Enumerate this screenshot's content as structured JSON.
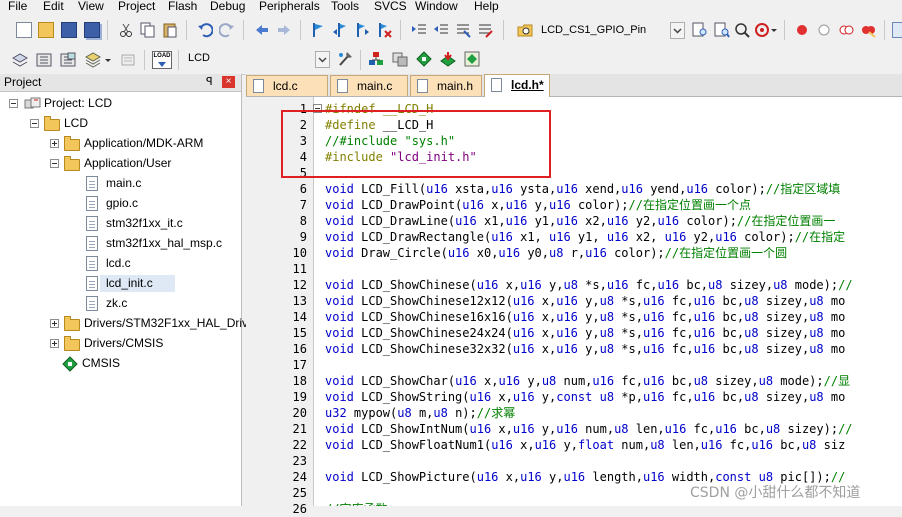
{
  "menu": [
    "File",
    "Edit",
    "View",
    "Project",
    "Flash",
    "Debug",
    "Peripherals",
    "Tools",
    "SVCS",
    "Window",
    "Help"
  ],
  "toolbar": {
    "target_combo": "LCD_CS1_GPIO_Pin",
    "project_combo": "LCD",
    "load_label": "LOAD"
  },
  "project_panel": {
    "title": "Project",
    "pin": "ꟼ",
    "close": "×",
    "root": "Project: LCD",
    "target": "LCD",
    "groups": [
      {
        "name": "Application/MDK-ARM",
        "expanded": false,
        "files": []
      },
      {
        "name": "Application/User",
        "expanded": true,
        "files": [
          "main.c",
          "gpio.c",
          "stm32f1xx_it.c",
          "stm32f1xx_hal_msp.c",
          "lcd.c",
          "lcd_init.c",
          "zk.c"
        ]
      },
      {
        "name": "Drivers/STM32F1xx_HAL_Driv",
        "expanded": false,
        "files": []
      },
      {
        "name": "Drivers/CMSIS",
        "expanded": false,
        "files": []
      },
      {
        "name": "CMSIS",
        "expanded": false,
        "files": []
      }
    ]
  },
  "tabs": [
    {
      "label": "lcd.c",
      "active": false
    },
    {
      "label": "main.c",
      "active": false
    },
    {
      "label": "main.h",
      "active": false
    },
    {
      "label": "lcd.h*",
      "active": true
    }
  ],
  "code_lines": [
    {
      "n": "1",
      "tokens": [
        [
          "p",
          "#ifndef __LCD_H"
        ]
      ]
    },
    {
      "n": "2",
      "tokens": [
        [
          "p",
          "#define "
        ],
        [
          "d",
          "__LCD_H"
        ]
      ]
    },
    {
      "n": "3",
      "tokens": [
        [
          "c",
          "//#include \"sys.h\""
        ]
      ]
    },
    {
      "n": "4",
      "tokens": [
        [
          "p",
          "#include "
        ],
        [
          "s",
          "\"lcd_init.h\""
        ]
      ]
    },
    {
      "n": "5",
      "tokens": []
    },
    {
      "n": "6",
      "tokens": [
        [
          "k",
          "void"
        ],
        [
          "d",
          " LCD_Fill("
        ],
        [
          "k",
          "u16"
        ],
        [
          "d",
          " xsta,"
        ],
        [
          "k",
          "u16"
        ],
        [
          "d",
          " ysta,"
        ],
        [
          "k",
          "u16"
        ],
        [
          "d",
          " xend,"
        ],
        [
          "k",
          "u16"
        ],
        [
          "d",
          " yend,"
        ],
        [
          "k",
          "u16"
        ],
        [
          "d",
          " color);"
        ],
        [
          "c",
          "//指定区域填"
        ]
      ]
    },
    {
      "n": "7",
      "tokens": [
        [
          "k",
          "void"
        ],
        [
          "d",
          " LCD_DrawPoint("
        ],
        [
          "k",
          "u16"
        ],
        [
          "d",
          " x,"
        ],
        [
          "k",
          "u16"
        ],
        [
          "d",
          " y,"
        ],
        [
          "k",
          "u16"
        ],
        [
          "d",
          " color);"
        ],
        [
          "c",
          "//在指定位置画一个点"
        ]
      ]
    },
    {
      "n": "8",
      "tokens": [
        [
          "k",
          "void"
        ],
        [
          "d",
          " LCD_DrawLine("
        ],
        [
          "k",
          "u16"
        ],
        [
          "d",
          " x1,"
        ],
        [
          "k",
          "u16"
        ],
        [
          "d",
          " y1,"
        ],
        [
          "k",
          "u16"
        ],
        [
          "d",
          " x2,"
        ],
        [
          "k",
          "u16"
        ],
        [
          "d",
          " y2,"
        ],
        [
          "k",
          "u16"
        ],
        [
          "d",
          " color);"
        ],
        [
          "c",
          "//在指定位置画一"
        ]
      ]
    },
    {
      "n": "9",
      "tokens": [
        [
          "k",
          "void"
        ],
        [
          "d",
          " LCD_DrawRectangle("
        ],
        [
          "k",
          "u16"
        ],
        [
          "d",
          " x1, "
        ],
        [
          "k",
          "u16"
        ],
        [
          "d",
          " y1, "
        ],
        [
          "k",
          "u16"
        ],
        [
          "d",
          " x2, "
        ],
        [
          "k",
          "u16"
        ],
        [
          "d",
          " y2,"
        ],
        [
          "k",
          "u16"
        ],
        [
          "d",
          " color);"
        ],
        [
          "c",
          "//在指定"
        ]
      ]
    },
    {
      "n": "10",
      "tokens": [
        [
          "k",
          "void"
        ],
        [
          "d",
          " Draw_Circle("
        ],
        [
          "k",
          "u16"
        ],
        [
          "d",
          " x0,"
        ],
        [
          "k",
          "u16"
        ],
        [
          "d",
          " y0,"
        ],
        [
          "k",
          "u8"
        ],
        [
          "d",
          " r,"
        ],
        [
          "k",
          "u16"
        ],
        [
          "d",
          " color);"
        ],
        [
          "c",
          "//在指定位置画一个圆"
        ]
      ]
    },
    {
      "n": "11",
      "tokens": []
    },
    {
      "n": "12",
      "tokens": [
        [
          "k",
          "void"
        ],
        [
          "d",
          " LCD_ShowChinese("
        ],
        [
          "k",
          "u16"
        ],
        [
          "d",
          " x,"
        ],
        [
          "k",
          "u16"
        ],
        [
          "d",
          " y,"
        ],
        [
          "k",
          "u8"
        ],
        [
          "d",
          " *s,"
        ],
        [
          "k",
          "u16"
        ],
        [
          "d",
          " fc,"
        ],
        [
          "k",
          "u16"
        ],
        [
          "d",
          " bc,"
        ],
        [
          "k",
          "u8"
        ],
        [
          "d",
          " sizey,"
        ],
        [
          "k",
          "u8"
        ],
        [
          "d",
          " mode);"
        ],
        [
          "c",
          "//"
        ]
      ]
    },
    {
      "n": "13",
      "tokens": [
        [
          "k",
          "void"
        ],
        [
          "d",
          " LCD_ShowChinese12x12("
        ],
        [
          "k",
          "u16"
        ],
        [
          "d",
          " x,"
        ],
        [
          "k",
          "u16"
        ],
        [
          "d",
          " y,"
        ],
        [
          "k",
          "u8"
        ],
        [
          "d",
          " *s,"
        ],
        [
          "k",
          "u16"
        ],
        [
          "d",
          " fc,"
        ],
        [
          "k",
          "u16"
        ],
        [
          "d",
          " bc,"
        ],
        [
          "k",
          "u8"
        ],
        [
          "d",
          " sizey,"
        ],
        [
          "k",
          "u8"
        ],
        [
          "d",
          " mo"
        ]
      ]
    },
    {
      "n": "14",
      "tokens": [
        [
          "k",
          "void"
        ],
        [
          "d",
          " LCD_ShowChinese16x16("
        ],
        [
          "k",
          "u16"
        ],
        [
          "d",
          " x,"
        ],
        [
          "k",
          "u16"
        ],
        [
          "d",
          " y,"
        ],
        [
          "k",
          "u8"
        ],
        [
          "d",
          " *s,"
        ],
        [
          "k",
          "u16"
        ],
        [
          "d",
          " fc,"
        ],
        [
          "k",
          "u16"
        ],
        [
          "d",
          " bc,"
        ],
        [
          "k",
          "u8"
        ],
        [
          "d",
          " sizey,"
        ],
        [
          "k",
          "u8"
        ],
        [
          "d",
          " mo"
        ]
      ]
    },
    {
      "n": "15",
      "tokens": [
        [
          "k",
          "void"
        ],
        [
          "d",
          " LCD_ShowChinese24x24("
        ],
        [
          "k",
          "u16"
        ],
        [
          "d",
          " x,"
        ],
        [
          "k",
          "u16"
        ],
        [
          "d",
          " y,"
        ],
        [
          "k",
          "u8"
        ],
        [
          "d",
          " *s,"
        ],
        [
          "k",
          "u16"
        ],
        [
          "d",
          " fc,"
        ],
        [
          "k",
          "u16"
        ],
        [
          "d",
          " bc,"
        ],
        [
          "k",
          "u8"
        ],
        [
          "d",
          " sizey,"
        ],
        [
          "k",
          "u8"
        ],
        [
          "d",
          " mo"
        ]
      ]
    },
    {
      "n": "16",
      "tokens": [
        [
          "k",
          "void"
        ],
        [
          "d",
          " LCD_ShowChinese32x32("
        ],
        [
          "k",
          "u16"
        ],
        [
          "d",
          " x,"
        ],
        [
          "k",
          "u16"
        ],
        [
          "d",
          " y,"
        ],
        [
          "k",
          "u8"
        ],
        [
          "d",
          " *s,"
        ],
        [
          "k",
          "u16"
        ],
        [
          "d",
          " fc,"
        ],
        [
          "k",
          "u16"
        ],
        [
          "d",
          " bc,"
        ],
        [
          "k",
          "u8"
        ],
        [
          "d",
          " sizey,"
        ],
        [
          "k",
          "u8"
        ],
        [
          "d",
          " mo"
        ]
      ]
    },
    {
      "n": "17",
      "tokens": []
    },
    {
      "n": "18",
      "tokens": [
        [
          "k",
          "void"
        ],
        [
          "d",
          " LCD_ShowChar("
        ],
        [
          "k",
          "u16"
        ],
        [
          "d",
          " x,"
        ],
        [
          "k",
          "u16"
        ],
        [
          "d",
          " y,"
        ],
        [
          "k",
          "u8"
        ],
        [
          "d",
          " num,"
        ],
        [
          "k",
          "u16"
        ],
        [
          "d",
          " fc,"
        ],
        [
          "k",
          "u16"
        ],
        [
          "d",
          " bc,"
        ],
        [
          "k",
          "u8"
        ],
        [
          "d",
          " sizey,"
        ],
        [
          "k",
          "u8"
        ],
        [
          "d",
          " mode);"
        ],
        [
          "c",
          "//显"
        ]
      ]
    },
    {
      "n": "19",
      "tokens": [
        [
          "k",
          "void"
        ],
        [
          "d",
          " LCD_ShowString("
        ],
        [
          "k",
          "u16"
        ],
        [
          "d",
          " x,"
        ],
        [
          "k",
          "u16"
        ],
        [
          "d",
          " y,"
        ],
        [
          "k",
          "const"
        ],
        [
          "d",
          " "
        ],
        [
          "k",
          "u8"
        ],
        [
          "d",
          " *p,"
        ],
        [
          "k",
          "u16"
        ],
        [
          "d",
          " fc,"
        ],
        [
          "k",
          "u16"
        ],
        [
          "d",
          " bc,"
        ],
        [
          "k",
          "u8"
        ],
        [
          "d",
          " sizey,"
        ],
        [
          "k",
          "u8"
        ],
        [
          "d",
          " mo"
        ]
      ]
    },
    {
      "n": "20",
      "tokens": [
        [
          "k",
          "u32"
        ],
        [
          "d",
          " mypow("
        ],
        [
          "k",
          "u8"
        ],
        [
          "d",
          " m,"
        ],
        [
          "k",
          "u8"
        ],
        [
          "d",
          " n);"
        ],
        [
          "c",
          "//求幂"
        ]
      ]
    },
    {
      "n": "21",
      "tokens": [
        [
          "k",
          "void"
        ],
        [
          "d",
          " LCD_ShowIntNum("
        ],
        [
          "k",
          "u16"
        ],
        [
          "d",
          " x,"
        ],
        [
          "k",
          "u16"
        ],
        [
          "d",
          " y,"
        ],
        [
          "k",
          "u16"
        ],
        [
          "d",
          " num,"
        ],
        [
          "k",
          "u8"
        ],
        [
          "d",
          " len,"
        ],
        [
          "k",
          "u16"
        ],
        [
          "d",
          " fc,"
        ],
        [
          "k",
          "u16"
        ],
        [
          "d",
          " bc,"
        ],
        [
          "k",
          "u8"
        ],
        [
          "d",
          " sizey);"
        ],
        [
          "c",
          "//"
        ]
      ]
    },
    {
      "n": "22",
      "tokens": [
        [
          "k",
          "void"
        ],
        [
          "d",
          " LCD_ShowFloatNum1("
        ],
        [
          "k",
          "u16"
        ],
        [
          "d",
          " x,"
        ],
        [
          "k",
          "u16"
        ],
        [
          "d",
          " y,"
        ],
        [
          "k",
          "float"
        ],
        [
          "d",
          " num,"
        ],
        [
          "k",
          "u8"
        ],
        [
          "d",
          " len,"
        ],
        [
          "k",
          "u16"
        ],
        [
          "d",
          " fc,"
        ],
        [
          "k",
          "u16"
        ],
        [
          "d",
          " bc,"
        ],
        [
          "k",
          "u8"
        ],
        [
          "d",
          " siz"
        ]
      ]
    },
    {
      "n": "23",
      "tokens": []
    },
    {
      "n": "24",
      "tokens": [
        [
          "k",
          "void"
        ],
        [
          "d",
          " LCD_ShowPicture("
        ],
        [
          "k",
          "u16"
        ],
        [
          "d",
          " x,"
        ],
        [
          "k",
          "u16"
        ],
        [
          "d",
          " y,"
        ],
        [
          "k",
          "u16"
        ],
        [
          "d",
          " length,"
        ],
        [
          "k",
          "u16"
        ],
        [
          "d",
          " width,"
        ],
        [
          "k",
          "const"
        ],
        [
          "d",
          " "
        ],
        [
          "k",
          "u8"
        ],
        [
          "d",
          " pic[]);"
        ],
        [
          "c",
          "//"
        ]
      ]
    },
    {
      "n": "25",
      "tokens": []
    },
    {
      "n": "26",
      "tokens": [
        [
          "c",
          "//字库函数"
        ]
      ]
    }
  ],
  "watermark": "CSDN @小甜什么都不知道",
  "colors": {
    "keyword": "#0000cc",
    "comment": "#008000",
    "preproc": "#808000",
    "string": "#800080",
    "highlight": "#e02020"
  }
}
